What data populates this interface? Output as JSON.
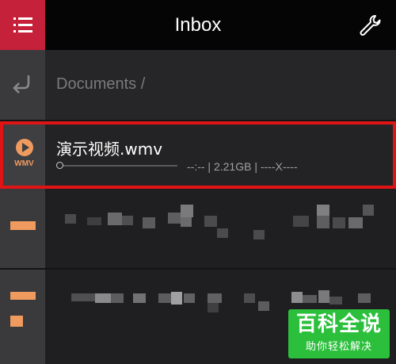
{
  "header": {
    "title": "Inbox",
    "menu_icon": "menu-icon",
    "settings_icon": "wrench-icon"
  },
  "navigation": {
    "back_icon": "back-arrow-icon",
    "path": "Documents /"
  },
  "selected_file": {
    "type_label": "WMV",
    "name": "演示视频.wmv",
    "progress": 0,
    "meta": "--:-- | 2.21GB | ----X----",
    "highlight_color": "#e01414"
  },
  "watermark": {
    "title": "百科全说",
    "subtitle": "助你轻松解决"
  },
  "colors": {
    "menu_accent": "#c6213a",
    "file_accent": "#ef9a5e",
    "watermark_green": "#2bbf3c"
  }
}
